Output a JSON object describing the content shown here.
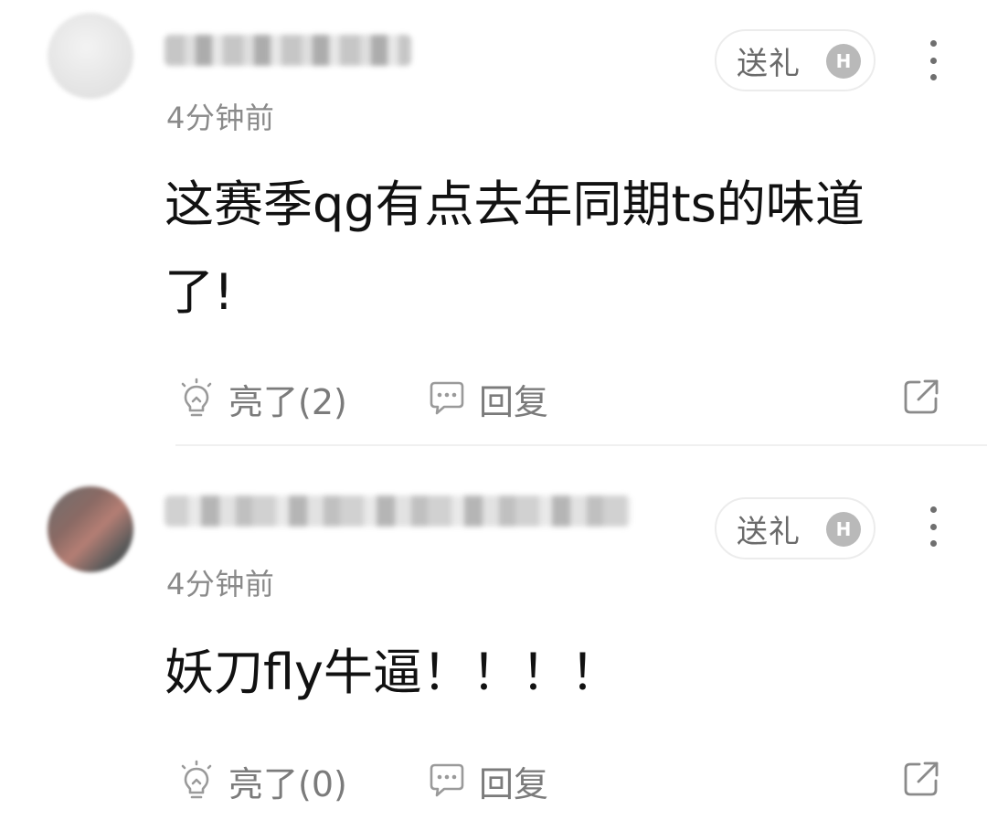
{
  "comments": [
    {
      "timestamp": "4分钟前",
      "gift_label": "送礼",
      "gift_badge": "H",
      "text": "这赛季qg有点去年同期ts的味道了!",
      "like_label": "亮了(2)",
      "reply_label": "回复"
    },
    {
      "timestamp": "4分钟前",
      "gift_label": "送礼",
      "gift_badge": "H",
      "text": "妖刀fly牛逼！！！！",
      "like_label": "亮了(0)",
      "reply_label": "回复"
    }
  ],
  "icons": {
    "like": "lightbulb-icon",
    "reply": "comment-bubble-icon",
    "share": "share-arrow-icon",
    "more": "more-vertical-icon",
    "gift_badge": "h-badge-icon"
  },
  "colors": {
    "text": "#111111",
    "muted": "#8a8a8a",
    "action": "#7b7b7b",
    "pill_border": "#ececec",
    "badge": "#b9b9b9"
  }
}
